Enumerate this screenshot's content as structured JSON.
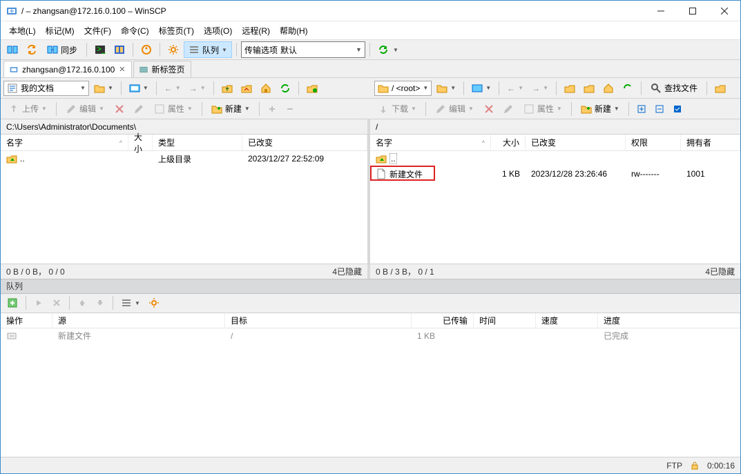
{
  "window": {
    "title": "/ – zhangsan@172.16.0.100 – WinSCP"
  },
  "menu": [
    "本地(L)",
    "标记(M)",
    "文件(F)",
    "命令(C)",
    "标签页(T)",
    "选项(O)",
    "远程(R)",
    "帮助(H)"
  ],
  "toolbar": {
    "sync_label": "同步",
    "queue_label": "队列",
    "transfer_label": "传输选项",
    "transfer_preset": "默认"
  },
  "tabs": [
    {
      "label": "zhangsan@172.16.0.100",
      "closable": true,
      "active": true
    },
    {
      "label": "新标签页",
      "closable": false,
      "active": false
    }
  ],
  "local": {
    "drive_label": "我的文档",
    "path": "C:\\Users\\Administrator\\Documents\\",
    "actions": {
      "upload": "上传",
      "edit": "编辑",
      "props": "属性",
      "new": "新建"
    },
    "cols": {
      "name": "名字",
      "size": "大小",
      "type": "类型",
      "changed": "已改变"
    },
    "rows": [
      {
        "name": "..",
        "size": "",
        "type": "上级目录",
        "changed": "2023/12/27 22:52:09",
        "up": true
      }
    ],
    "status_left": "0 B / 0 B， 0 / 0",
    "status_right": "4已隐藏"
  },
  "remote": {
    "drive_label": "/ <root>",
    "path": "/",
    "actions": {
      "download": "下载",
      "edit": "编辑",
      "props": "属性",
      "new": "新建",
      "find": "查找文件"
    },
    "cols": {
      "name": "名字",
      "size": "大小",
      "changed": "已改变",
      "rights": "权限",
      "owner": "拥有者"
    },
    "rows": [
      {
        "name": "..",
        "size": "",
        "changed": "",
        "rights": "",
        "owner": "",
        "up": true
      },
      {
        "name": "新建文件",
        "size": "1 KB",
        "changed": "2023/12/28 23:26:46",
        "rights": "rw-------",
        "owner": "1001",
        "highlight": true
      }
    ],
    "status_left": "0 B / 3 B， 0 / 1",
    "status_right": "4已隐藏"
  },
  "queue": {
    "title": "队列",
    "cols": {
      "op": "操作",
      "src": "源",
      "dst": "目标",
      "xfer": "已传输",
      "time": "时间",
      "speed": "速度",
      "prog": "进度"
    },
    "rows": [
      {
        "src": "新建文件",
        "dst": "/",
        "xfer": "1 KB",
        "time": "",
        "speed": "",
        "prog": "已完成"
      }
    ]
  },
  "statusbar": {
    "proto": "FTP",
    "elapsed": "0:00:16"
  }
}
